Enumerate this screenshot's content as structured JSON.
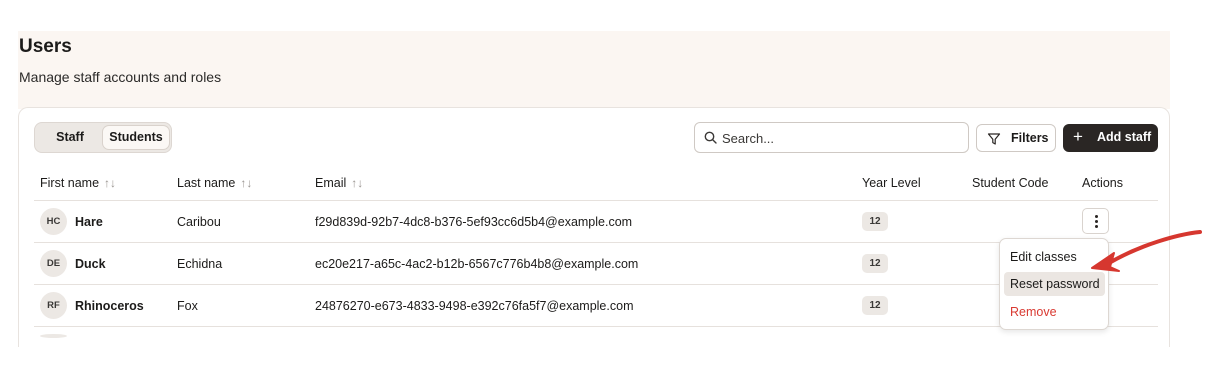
{
  "page": {
    "title": "Users",
    "subtitle": "Manage staff accounts and roles"
  },
  "tabs": {
    "staff": "Staff",
    "students": "Students",
    "selected": "Students"
  },
  "toolbar": {
    "search_placeholder": "Search...",
    "filters_label": "Filters",
    "add_label": "Add staff",
    "add_plus": "+"
  },
  "table": {
    "columns": {
      "first_name": "First name",
      "last_name": "Last name",
      "email": "Email",
      "year_level": "Year Level",
      "student_code": "Student Code",
      "actions": "Actions"
    },
    "sort_glyph": "↑↓",
    "rows": [
      {
        "initials": "HC",
        "first_name": "Hare",
        "last_name": "Caribou",
        "email": "f29d839d-92b7-4dc8-b376-5ef93cc6d5b4@example.com",
        "year_level": "12",
        "student_code": ""
      },
      {
        "initials": "DE",
        "first_name": "Duck",
        "last_name": "Echidna",
        "email": "ec20e217-a65c-4ac2-b12b-6567c776b4b8@example.com",
        "year_level": "12",
        "student_code": ""
      },
      {
        "initials": "RF",
        "first_name": "Rhinoceros",
        "last_name": "Fox",
        "email": "24876270-e673-4833-9498-e392c76fa5f7@example.com",
        "year_level": "12",
        "student_code": ""
      }
    ]
  },
  "action_menu": {
    "items": [
      "Edit classes",
      "Reset password",
      "Remove"
    ],
    "highlighted": "Reset password",
    "danger_color": "#d93a32"
  },
  "colors": {
    "accent_dark": "#2a2624",
    "header_band": "#fbf6f2",
    "annotation_arrow": "#d6372f"
  }
}
